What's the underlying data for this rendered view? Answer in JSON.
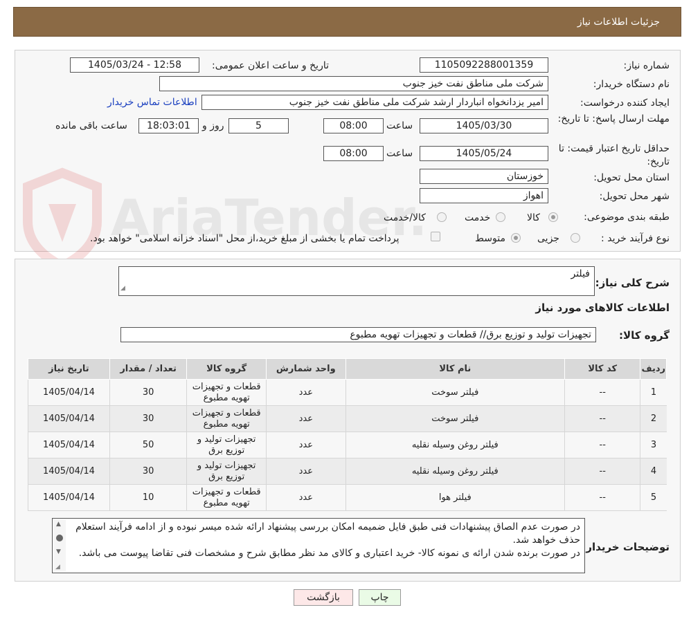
{
  "header": {
    "title": "جزئیات اطلاعات نیاز"
  },
  "form": {
    "need_number_label": "شماره نیاز:",
    "need_number": "1105092288001359",
    "announce_label": "تاریخ و ساعت اعلان عمومی:",
    "announce_value": "1405/03/24 - 12:58",
    "buyer_org_label": "نام دستگاه خریدار:",
    "buyer_org": "شرکت ملی مناطق نفت خیز جنوب",
    "creator_label": "ایجاد کننده درخواست:",
    "creator": "امیر یزدانخواه انباردار ارشد شرکت ملی مناطق نفت خیز جنوب",
    "contact_link": "اطلاعات تماس خریدار",
    "reply_deadline_label": "مهلت ارسال پاسخ: تا تاریخ:",
    "reply_date": "1405/03/30",
    "time_label": "ساعت",
    "reply_time": "08:00",
    "days_value": "5",
    "days_label": "روز و",
    "remaining_time": "18:03:01",
    "remaining_label": "ساعت باقی مانده",
    "validity_label": "حداقل تاریخ اعتبار قیمت: تا تاریخ:",
    "validity_date": "1405/05/24",
    "validity_time": "08:00",
    "province_label": "استان محل تحویل:",
    "province": "خوزستان",
    "city_label": "شهر محل تحویل:",
    "city": "اهواز",
    "category_label": "طبقه بندی موضوعی:",
    "category_options": [
      "کالا",
      "خدمت",
      "کالا/خدمت"
    ],
    "process_label": "نوع فرآیند خرید :",
    "process_options": [
      "جزیی",
      "متوسط"
    ],
    "payment_text": "پرداخت تمام یا بخشی از مبلغ خرید،از محل \"اسناد خزانه اسلامی\" خواهد بود."
  },
  "summary": {
    "label": "شرح کلی نیاز:",
    "value": "فیلتر",
    "goods_info_title": "اطلاعات کالاهای مورد نیاز",
    "goods_group_label": "گروه کالا:",
    "goods_group": "تجهیزات تولید و توزیع برق//  قطعات و تجهیزات تهویه مطبوع"
  },
  "table": {
    "headers": [
      "ردیف",
      "کد کالا",
      "نام کالا",
      "واحد شمارش",
      "گروه کالا",
      "تعداد / مقدار",
      "تاریخ نیاز"
    ],
    "rows": [
      [
        "1",
        "--",
        "فیلتر سوخت",
        "عدد",
        "قطعات و تجهیزات تهویه مطبوع",
        "30",
        "1405/04/14"
      ],
      [
        "2",
        "--",
        "فیلتر سوخت",
        "عدد",
        "قطعات و تجهیزات تهویه مطبوع",
        "30",
        "1405/04/14"
      ],
      [
        "3",
        "--",
        "فیلتر روغن وسیله نقلیه",
        "عدد",
        "تجهیزات تولید و توزیع برق",
        "50",
        "1405/04/14"
      ],
      [
        "4",
        "--",
        "فیلتر روغن وسیله نقلیه",
        "عدد",
        "تجهیزات تولید و توزیع برق",
        "30",
        "1405/04/14"
      ],
      [
        "5",
        "--",
        "فیلتر هوا",
        "عدد",
        "قطعات و تجهیزات تهویه مطبوع",
        "10",
        "1405/04/14"
      ]
    ]
  },
  "notes": {
    "label": "توضیحات خریدار:",
    "text": "در صورت عدم الصاق پیشنهادات فنی طبق فایل ضمیمه امکان بررسی پیشنهاد ارائه شده میسر نبوده و از ادامه فرآیند استعلام حذف خواهد شد.\nدر صورت برنده شدن ارائه ی نمونه کالا- خرید اعتباری و کالای مد نظر مطابق شرح و مشخصات فنی تقاضا پیوست می باشد."
  },
  "buttons": {
    "print": "چاپ",
    "back": "بازگشت"
  },
  "watermark": {
    "text": "AriaTender.neT"
  },
  "colors": {
    "header_bg": "#8b6a45",
    "print_btn": "#eafbe6",
    "back_btn": "#fde8e8",
    "link": "#1a3fbf"
  }
}
